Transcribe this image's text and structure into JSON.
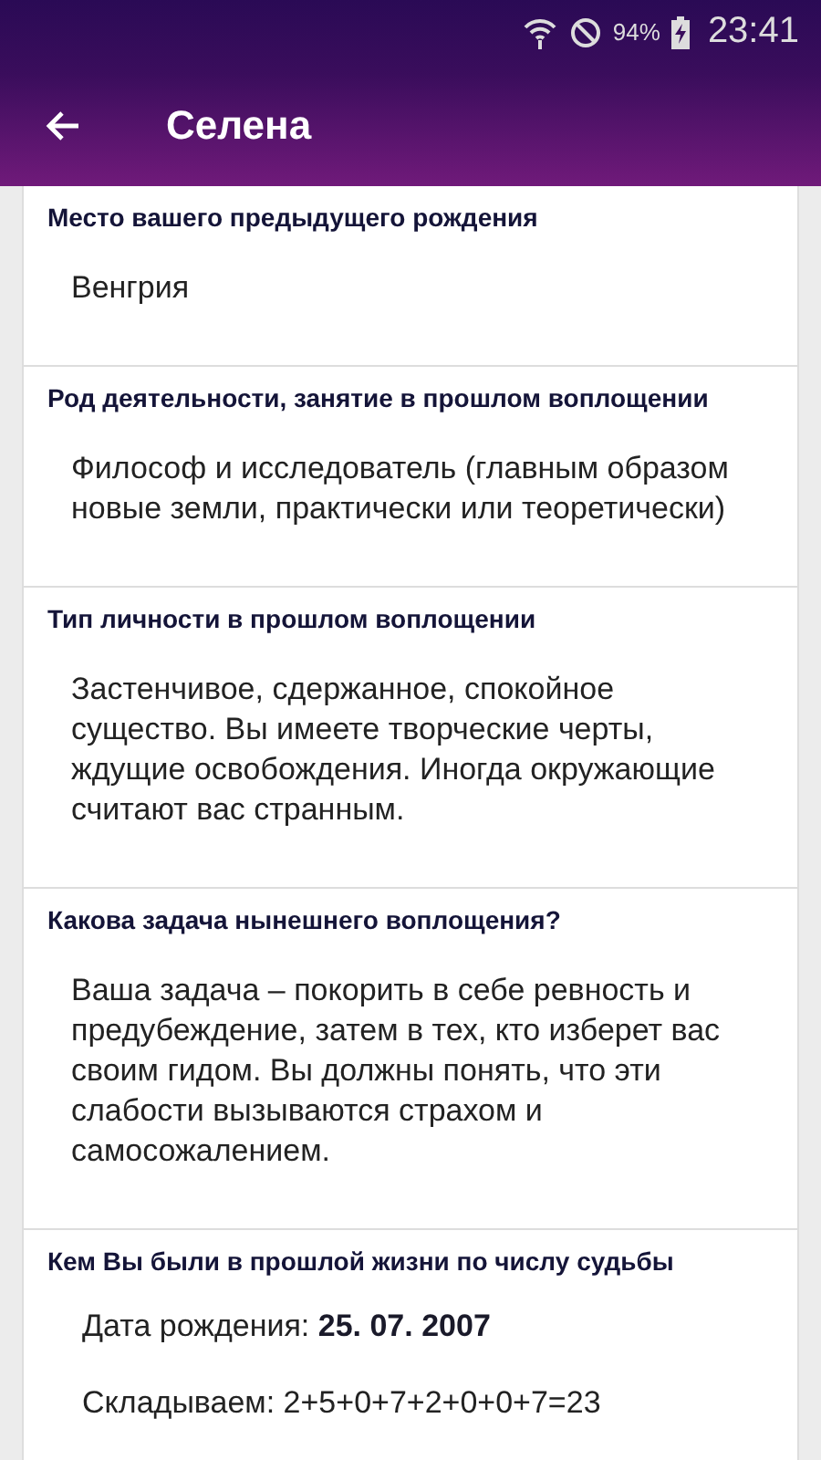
{
  "status_bar": {
    "battery": "94%",
    "time": "23:41"
  },
  "toolbar": {
    "title": "Селена"
  },
  "sections": [
    {
      "heading": "Место вашего предыдущего рождения",
      "lines": [
        "Венгрия"
      ]
    },
    {
      "heading": "Род деятельности, занятие в прошлом воплощении",
      "lines": [
        "Философ и исследователь (главным образом новые земли, практически или теоретически)"
      ]
    },
    {
      "heading": "Тип личности в прошлом воплощении",
      "lines": [
        "Застенчивое, сдержанное, спокойное существо. Вы имеете творческие черты, ждущие освобождения. Иногда окружающие считают вас странным."
      ]
    },
    {
      "heading": "Какова задача нынешнего воплощения?",
      "lines": [
        "Ваша задача – покорить в себе ревность и предубеждение, затем в тех, кто изберет вас своим гидом. Вы должны понять, что эти слабости вызываются страхом и самосожалением."
      ]
    },
    {
      "heading": "Кем Вы были в прошлой жизни по числу судьбы",
      "lines": [
        "Дата рождения: **25. 07. 2007**",
        "Складываем: 2+5+0+7+2+0+0+7=23"
      ]
    }
  ]
}
